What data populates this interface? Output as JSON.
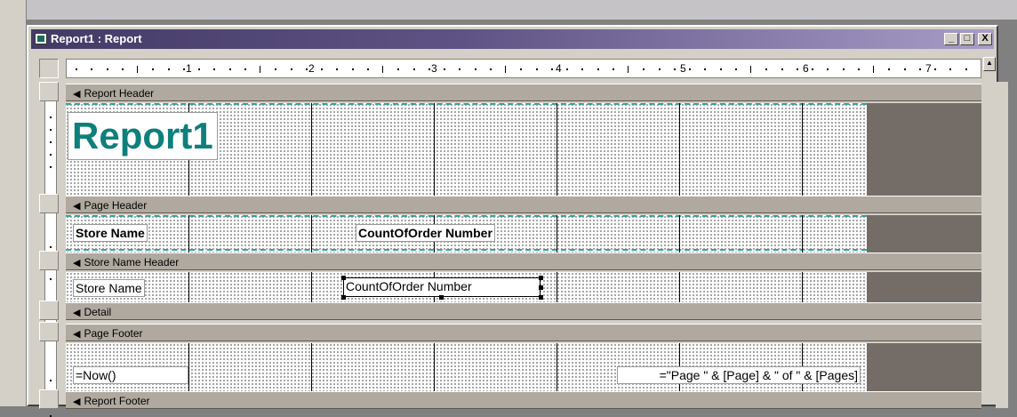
{
  "window": {
    "title": "Report1 : Report",
    "buttons": {
      "minimize": "_",
      "maximize": "□",
      "close": "X"
    }
  },
  "ruler": {
    "labels": [
      "1",
      "2",
      "3",
      "4",
      "5",
      "6",
      "7"
    ]
  },
  "sections": {
    "report_header": "Report Header",
    "page_header": "Page Header",
    "store_name_header": "Store Name Header",
    "detail": "Detail",
    "page_footer": "Page Footer",
    "report_footer": "Report Footer"
  },
  "report_header": {
    "title": "Report1"
  },
  "page_header": {
    "label_store_name": "Store Name",
    "label_count": "CountOfOrder Number"
  },
  "store_name_header": {
    "field_store_name": "Store Name",
    "field_count": "CountOfOrder Number"
  },
  "page_footer": {
    "field_now": "=Now()",
    "field_page": "=\"Page \" & [Page] & \" of \" & [Pages]"
  },
  "colors": {
    "title_teal": "#0e7f7c",
    "section_bar": "#b0a9a0",
    "titlebar_start": "#443a66",
    "titlebar_end": "#a89cc8"
  }
}
